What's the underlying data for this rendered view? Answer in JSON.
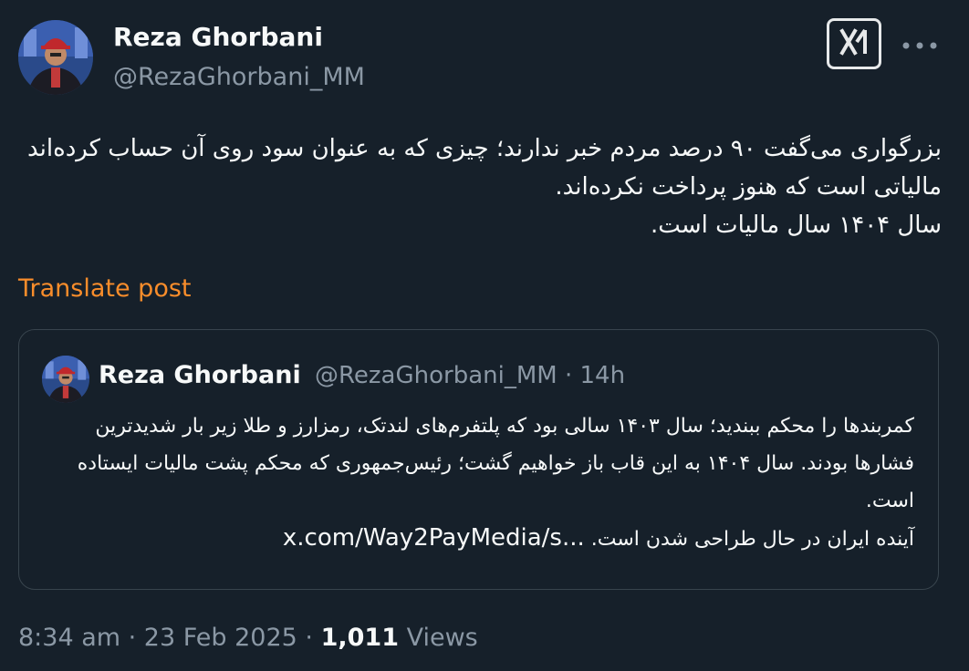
{
  "author": {
    "name": "Reza Ghorbani",
    "handle": "@RezaGhorbani_MM"
  },
  "header": {
    "grok_icon": "grok-icon",
    "more_icon": "more-horizontal-icon"
  },
  "tweet": {
    "text": "بزرگواری می‌گفت ۹۰ درصد مردم خبر ندارند؛ چیزی که به عنوان سود روی آن حساب کرده‌اند مالیاتی است که هنوز پرداخت نکرده‌اند.\nسال ۱۴۰۴ سال مالیات است.",
    "translate_label": "Translate post"
  },
  "quote": {
    "name": "Reza Ghorbani",
    "handle_time": "@RezaGhorbani_MM · 14h",
    "text": "کمربندها را محکم ببندید؛ سال ۱۴۰۳ سالی بود که پلتفرم‌های لندتک، رمزارز و طلا زیر بار شدیدترین فشارها بودند. سال ۱۴۰۴ به این قاب باز خواهیم گشت؛ رئیس‌جمهوری که محکم پشت مالیات ایستاده است.\nآینده ایران در حال طراحی شدن است. ",
    "link": "x.com/Way2PayMedia/s..."
  },
  "meta": {
    "time_date": "8:34 am · 23 Feb 2025 · ",
    "views_count": "1,011",
    "views_label": " Views"
  },
  "colors": {
    "background": "#16202a",
    "text": "#f7f9f9",
    "secondary": "#8b98a5",
    "accent": "#f98d2b",
    "border": "#38444d"
  }
}
